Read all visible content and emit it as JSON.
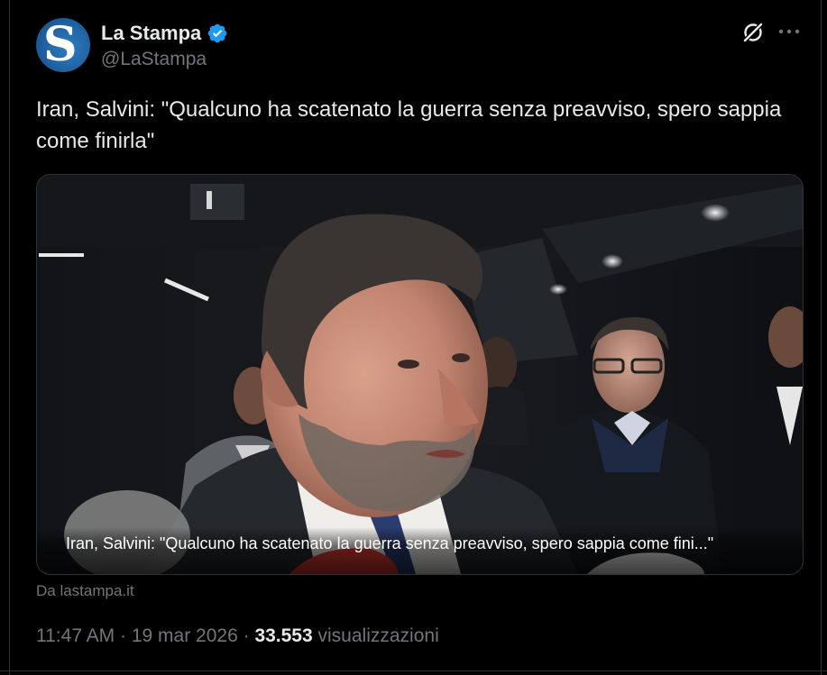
{
  "author": {
    "display_name": "La Stampa",
    "handle": "@LaStampa",
    "avatar_letter": "S",
    "verified": true,
    "verified_color": "#1d9bf0"
  },
  "tweet": {
    "text": "Iran, Salvini: \"Qualcuno ha scatenato la guerra senza preavviso, spero sappia come finirla\""
  },
  "media": {
    "caption": "Iran, Salvini: \"Qualcuno ha scatenato la guerra senza preavviso, spero sappia come fini...\""
  },
  "source": {
    "label": "Da lastampa.it"
  },
  "meta": {
    "time": "11:47 AM",
    "separator": " · ",
    "date": "19 mar 2026",
    "views_count": "33.553",
    "views_label": "visualizzazioni"
  },
  "icons": {
    "grok": "grok-icon",
    "more": "more-icon",
    "verified": "verified-badge-icon"
  },
  "colors": {
    "background": "#000000",
    "text_primary": "#e7e9ea",
    "text_secondary": "#71767b",
    "border": "#2f3336"
  }
}
